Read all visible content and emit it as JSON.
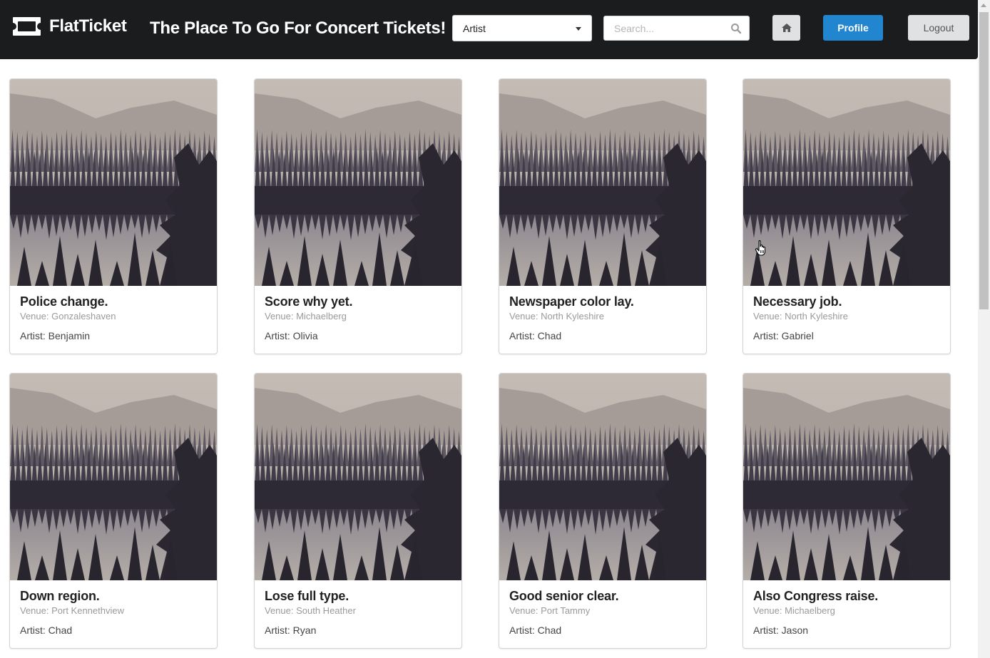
{
  "header": {
    "brand": "FlatTicket",
    "tagline": "The Place To Go For Concert Tickets!",
    "filter_select": {
      "value": "Artist"
    },
    "search": {
      "placeholder": "Search..."
    },
    "buttons": {
      "home_icon": "home-icon",
      "profile": "Profile",
      "logout": "Logout"
    }
  },
  "colors": {
    "topbar": "#1b1c1d",
    "primary": "#2185d0",
    "button_gray": "#e0e1e2"
  },
  "events": [
    {
      "title": "Police change.",
      "venue": "Venue: Gonzaleshaven",
      "artist": "Artist: Benjamin"
    },
    {
      "title": "Score why yet.",
      "venue": "Venue: Michaelberg",
      "artist": "Artist: Olivia"
    },
    {
      "title": "Newspaper color lay.",
      "venue": "Venue: North Kyleshire",
      "artist": "Artist: Chad"
    },
    {
      "title": "Necessary job.",
      "venue": "Venue: North Kyleshire",
      "artist": "Artist: Gabriel"
    },
    {
      "title": "Down region.",
      "venue": "Venue: Port Kennethview",
      "artist": "Artist: Chad"
    },
    {
      "title": "Lose full type.",
      "venue": "Venue: South Heather",
      "artist": "Artist: Ryan"
    },
    {
      "title": "Good senior clear.",
      "venue": "Venue: Port Tammy",
      "artist": "Artist: Chad"
    },
    {
      "title": "Also Congress raise.",
      "venue": "Venue: Michaelberg",
      "artist": "Artist: Jason"
    }
  ]
}
